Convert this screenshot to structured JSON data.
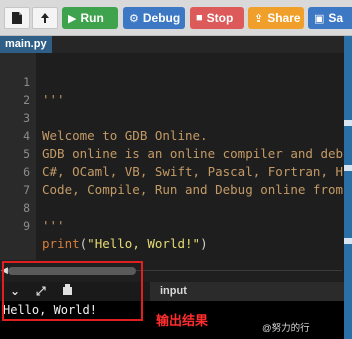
{
  "toolbar": {
    "buttons": [
      {
        "label": "Run",
        "icon": "play-icon",
        "color": "#3fa34d"
      },
      {
        "label": "Debug",
        "icon": "gear-icon",
        "color": "#3c78c3"
      },
      {
        "label": "Stop",
        "icon": "stop-icon",
        "color": "#dd5a5a"
      },
      {
        "label": "Share",
        "icon": "share-icon",
        "color": "#f0a02a"
      },
      {
        "label": "Sa",
        "icon": "save-icon",
        "color": "#3c78c3"
      }
    ]
  },
  "tabs": [
    {
      "label": "main.py"
    }
  ],
  "editor": {
    "lines": [
      {
        "num": "1",
        "text": "'''"
      },
      {
        "num": "2",
        "text": ""
      },
      {
        "num": "3",
        "text": "Welcome to GDB Online."
      },
      {
        "num": "4",
        "text": "GDB online is an online compiler and deb"
      },
      {
        "num": "5",
        "text": "C#, OCaml, VB, Swift, Pascal, Fortran, H"
      },
      {
        "num": "6",
        "text": "Code, Compile, Run and Debug online from"
      },
      {
        "num": "7",
        "text": ""
      },
      {
        "num": "8",
        "text": "'''"
      },
      {
        "num": "9",
        "fn": "print",
        "open": "(",
        "str": "\"Hello, World!\"",
        "close": ")"
      }
    ]
  },
  "io": {
    "input_label": "input",
    "output_text": "Hello, World!"
  },
  "annotation": "输出结果",
  "watermark": "@努力的行"
}
